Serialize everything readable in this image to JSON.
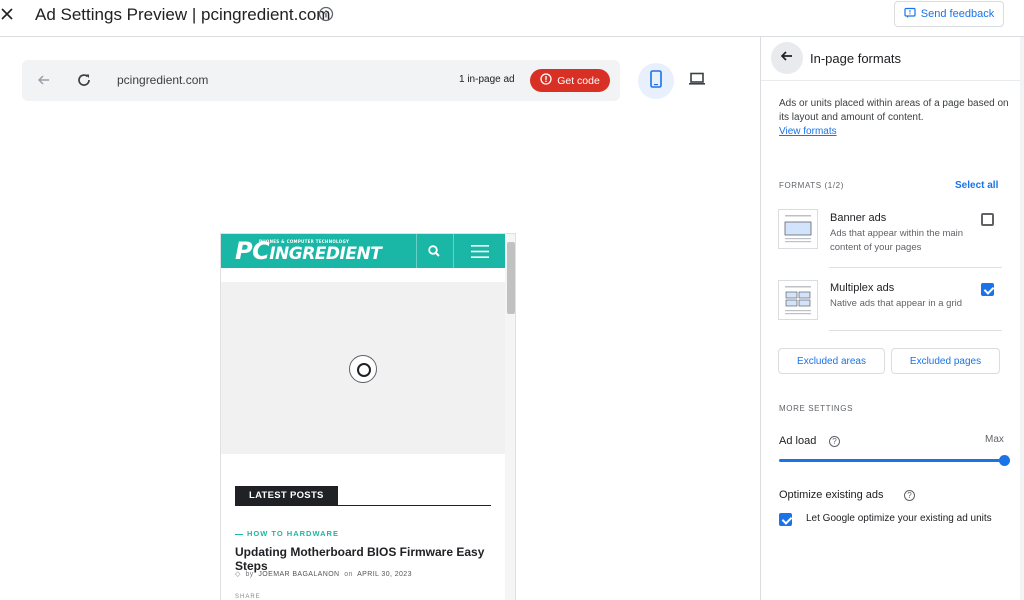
{
  "window": {
    "title": "Ad Settings Preview | pcingredient.com",
    "feedback_label": "Send feedback"
  },
  "browser": {
    "url": "pcingredient.com",
    "ad_count": "1 in-page ad",
    "get_code_label": "Get code"
  },
  "site": {
    "logo_pc": "PC",
    "logo_rest": "INGREDIENT",
    "logo_tagline": "PHONES & COMPUTER TECHNOLOGY",
    "latest_label": "LATEST POSTS",
    "post": {
      "category": "HOW TO HARDWARE",
      "title": "Updating Motherboard BIOS Firmware Easy Steps",
      "by": "by",
      "author": "JOEMAR BAGALANON",
      "on": "on",
      "date": "APRIL 30, 2023",
      "share": "SHARE"
    }
  },
  "panel": {
    "title": "In-page formats",
    "description": "Ads or units placed within areas of a page based on its layout and amount of content.",
    "view_formats": "View formats",
    "formats_label": "FORMATS (1/2)",
    "select_all": "Select all",
    "formats": [
      {
        "name": "Banner ads",
        "description": "Ads that appear within the main content of your pages",
        "checked": false
      },
      {
        "name": "Multiplex ads",
        "description": "Native ads that appear in a grid",
        "checked": true
      }
    ],
    "excluded_areas": "Excluded areas",
    "excluded_pages": "Excluded pages",
    "more_settings": "MORE SETTINGS",
    "ad_load_label": "Ad load",
    "ad_load_max": "Max",
    "ad_load_level": 1.0,
    "optimize_label": "Optimize existing ads",
    "optimize_checkbox": "Let Google optimize your existing ad units",
    "optimize_checked": true
  },
  "colors": {
    "accent": "#1a73e8",
    "get_code": "#d93025",
    "site_header": "#1ab7a6"
  }
}
